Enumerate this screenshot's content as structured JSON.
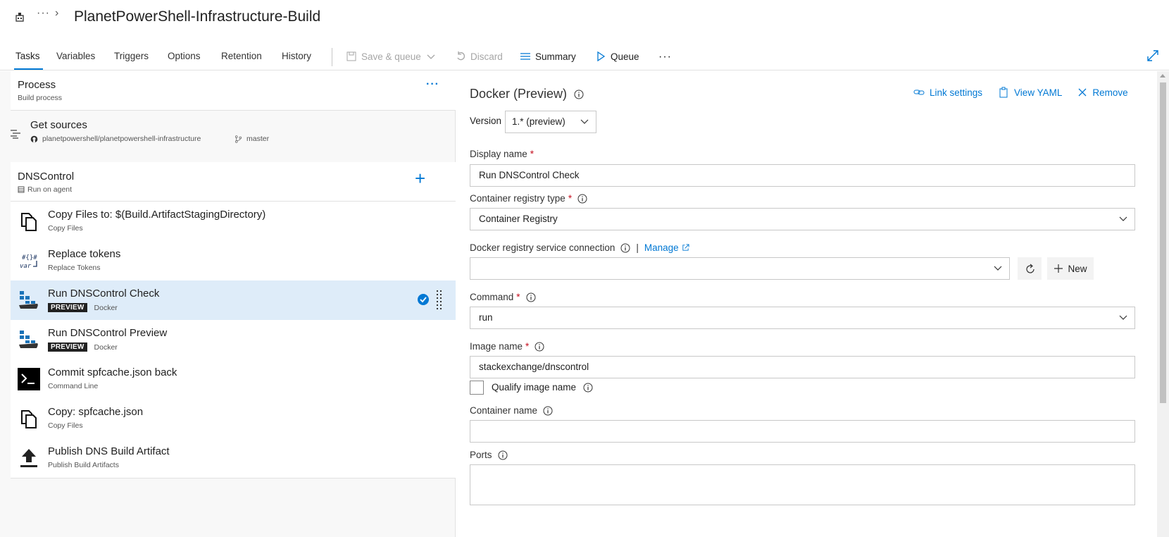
{
  "header": {
    "title": "PlanetPowerShell-Infrastructure-Build",
    "overflow_icon": "ellipsis-icon",
    "breadcrumb_chevron": "chevron-right-icon"
  },
  "tabs": [
    {
      "label": "Tasks",
      "active": true
    },
    {
      "label": "Variables"
    },
    {
      "label": "Triggers"
    },
    {
      "label": "Options"
    },
    {
      "label": "Retention"
    },
    {
      "label": "History"
    }
  ],
  "toolbar": {
    "save_queue": "Save & queue",
    "discard": "Discard",
    "summary": "Summary",
    "queue": "Queue"
  },
  "process": {
    "title": "Process",
    "subtitle": "Build process"
  },
  "sources": {
    "title": "Get sources",
    "repo": "planetpowershell/planetpowershell-infrastructure",
    "branch": "master"
  },
  "phase": {
    "title": "DNSControl",
    "subtitle": "Run on agent"
  },
  "tasks": [
    {
      "title": "Copy Files to: $(Build.ArtifactStagingDirectory)",
      "subtitle": "Copy Files",
      "icon": "copy-files-icon"
    },
    {
      "title": "Replace tokens",
      "subtitle": "Replace Tokens",
      "icon": "replace-tokens-icon"
    },
    {
      "title": "Run DNSControl Check",
      "subtitle": "Docker",
      "badge": "PREVIEW",
      "icon": "docker-icon",
      "selected": true
    },
    {
      "title": "Run DNSControl Preview",
      "subtitle": "Docker",
      "badge": "PREVIEW",
      "icon": "docker-icon"
    },
    {
      "title": "Commit spfcache.json back",
      "subtitle": "Command Line",
      "icon": "command-line-icon"
    },
    {
      "title": "Copy: spfcache.json",
      "subtitle": "Copy Files",
      "icon": "copy-files-icon"
    },
    {
      "title": "Publish DNS Build Artifact",
      "subtitle": "Publish Build Artifacts",
      "icon": "publish-artifact-icon"
    }
  ],
  "detail": {
    "title": "Docker (Preview)",
    "link_settings": "Link settings",
    "view_yaml": "View YAML",
    "remove": "Remove",
    "version_label": "Version",
    "version_value": "1.* (preview)",
    "display_name_label": "Display name",
    "display_name_value": "Run DNSControl Check",
    "registry_type_label": "Container registry type",
    "registry_type_value": "Container Registry",
    "service_conn_label": "Docker registry service connection",
    "manage": "Manage",
    "service_conn_value": "",
    "new_button": "New",
    "command_label": "Command",
    "command_value": "run",
    "image_name_label": "Image name",
    "image_name_value": "stackexchange/dnscontrol",
    "qualify_label": "Qualify image name",
    "container_name_label": "Container name",
    "container_name_value": "",
    "ports_label": "Ports",
    "required_mark": "*"
  },
  "colors": {
    "accent": "#0078d4",
    "selected_bg": "#deecf9",
    "required": "#c50f1f"
  }
}
